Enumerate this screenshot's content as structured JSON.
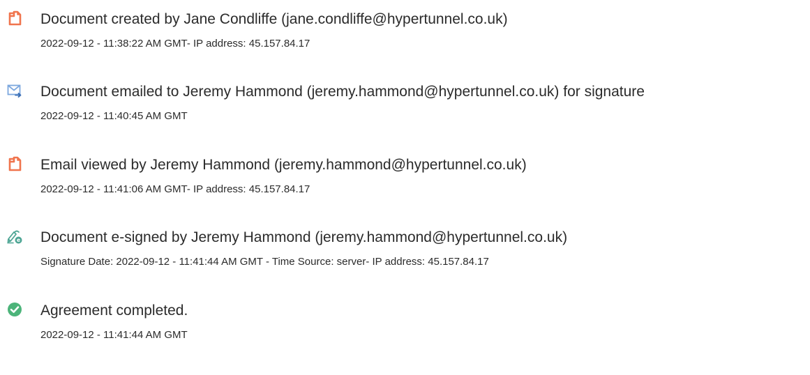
{
  "colors": {
    "document_icon": "#F0744D",
    "email_icon": "#7CA7DE",
    "esign_icon": "#4DA594",
    "complete_icon": "#4CB47A",
    "text": "#2B2B2B"
  },
  "events": [
    {
      "icon": "document-icon",
      "title": "Document created by Jane Condliffe (jane.condliffe@hypertunnel.co.uk)",
      "detail": "2022-09-12 - 11:38:22 AM GMT- IP address: 45.157.84.17"
    },
    {
      "icon": "email-icon",
      "title": "Document emailed to Jeremy Hammond (jeremy.hammond@hypertunnel.co.uk) for signature",
      "detail": "2022-09-12 - 11:40:45 AM GMT"
    },
    {
      "icon": "document-icon",
      "title": "Email viewed by Jeremy Hammond (jeremy.hammond@hypertunnel.co.uk)",
      "detail": "2022-09-12 - 11:41:06 AM GMT- IP address: 45.157.84.17"
    },
    {
      "icon": "e-sign-icon",
      "title": "Document e-signed by Jeremy Hammond (jeremy.hammond@hypertunnel.co.uk)",
      "detail": "Signature Date: 2022-09-12 - 11:41:44 AM GMT - Time Source: server- IP address: 45.157.84.17"
    },
    {
      "icon": "check-circle-icon",
      "title": "Agreement completed.",
      "detail": "2022-09-12 - 11:41:44 AM GMT"
    }
  ]
}
